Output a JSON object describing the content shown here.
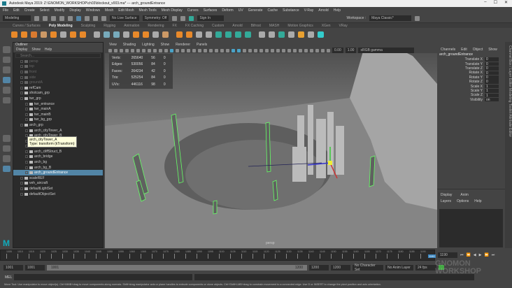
{
  "window": {
    "title": "Autodesk Maya 2019: Z:\\GNOMON_WORKSHOP\\ch03\\blockout_v003.ma*  ---  arch_groundEntrance",
    "minimize": "–",
    "maximize": "☐",
    "close": "✕"
  },
  "menubar": [
    "File",
    "Edit",
    "Create",
    "Select",
    "Modify",
    "Display",
    "Windows",
    "Mesh",
    "Edit Mesh",
    "Mesh Tools",
    "Mesh Display",
    "Curves",
    "Surfaces",
    "Deform",
    "UV",
    "Generate",
    "Cache",
    "Substance",
    "V-Ray",
    "Arnold",
    "Help"
  ],
  "status": {
    "mode": "Modeling",
    "live_surface": "No Live Surface",
    "symmetry": "Symmetry: Off",
    "sign_in": "Sign In",
    "workspace_label": "Workspace :",
    "workspace": "Maya Classic*"
  },
  "shelf_tabs": [
    "Curves / Surfaces",
    "Poly Modeling",
    "Sculpting",
    "Rigging",
    "Animation",
    "Rendering",
    "FX",
    "FX Caching",
    "Custom",
    "Arnold",
    "Bifrost",
    "MASH",
    "Motion Graphics",
    "XGen",
    "VRay"
  ],
  "shelf_active": "Poly Modeling",
  "outliner": {
    "title": "Outliner",
    "menu": [
      "Display",
      "Show",
      "Help"
    ],
    "search_placeholder": "Search...",
    "items": [
      {
        "label": "persp",
        "dim": true,
        "indent": 0
      },
      {
        "label": "top",
        "dim": true,
        "indent": 0
      },
      {
        "label": "front",
        "dim": true,
        "indent": 0
      },
      {
        "label": "side",
        "dim": true,
        "indent": 0
      },
      {
        "label": "groundA",
        "dim": true,
        "indent": 0
      },
      {
        "label": "refCam",
        "indent": 0
      },
      {
        "label": "shotcam_grp",
        "indent": 0
      },
      {
        "label": "twr_grp",
        "indent": 0
      },
      {
        "label": "twr_entrance",
        "indent": 1
      },
      {
        "label": "twr_mainA",
        "indent": 1
      },
      {
        "label": "twr_mainB",
        "indent": 1
      },
      {
        "label": "twr_bg_grp",
        "indent": 1
      },
      {
        "label": "arch_grp",
        "indent": 0
      },
      {
        "label": "arch_cityTower_A",
        "indent": 1
      },
      {
        "label": "arch_cityTower_B",
        "indent": 1
      },
      {
        "label": "arch_cliff",
        "indent": 1
      },
      {
        "label": "arch_cliffStruct_A",
        "indent": 1
      },
      {
        "label": "arch_cliffStruct_B",
        "indent": 1
      },
      {
        "label": "arch_bridge",
        "indent": 1
      },
      {
        "label": "arch_bg",
        "indent": 1
      },
      {
        "label": "arch_bg_B",
        "indent": 1
      },
      {
        "label": "arch_groundEntrance",
        "indent": 1,
        "selected": true
      },
      {
        "label": "scaleREF",
        "indent": 0
      },
      {
        "label": "veh_aircraft",
        "indent": 0
      },
      {
        "label": "defaultLightSet",
        "indent": 0
      },
      {
        "label": "defaultObjectSet",
        "indent": 0
      }
    ],
    "tooltip": {
      "name": "arch_cityTower_A",
      "type": "Type: transform (kTransform)"
    }
  },
  "viewport": {
    "menu": [
      "View",
      "Shading",
      "Lighting",
      "Show",
      "Renderer",
      "Panels"
    ],
    "exposure": "0.00",
    "gamma": "1.00",
    "color_space": "sRGB gamma",
    "camera": "persp",
    "stats": [
      {
        "label": "Verts:",
        "v": "265640",
        "a": "56",
        "b": "0"
      },
      {
        "label": "Edges:",
        "v": "530056",
        "a": "84",
        "b": "0"
      },
      {
        "label": "Faces:",
        "v": "264234",
        "a": "42",
        "b": "0"
      },
      {
        "label": "Tris:",
        "v": "525254",
        "a": "84",
        "b": "0"
      },
      {
        "label": "UVs:",
        "v": "446116",
        "a": "98",
        "b": "0"
      }
    ]
  },
  "channel_box": {
    "menu": [
      "Channels",
      "Edit",
      "Object",
      "Show"
    ],
    "object": "arch_groundEntrance",
    "channels": [
      {
        "l": "Translate X",
        "v": "0"
      },
      {
        "l": "Translate Y",
        "v": "0"
      },
      {
        "l": "Translate Z",
        "v": "0"
      },
      {
        "l": "Rotate X",
        "v": "0"
      },
      {
        "l": "Rotate Y",
        "v": "0"
      },
      {
        "l": "Rotate Z",
        "v": "0"
      },
      {
        "l": "Scale X",
        "v": "1"
      },
      {
        "l": "Scale Y",
        "v": "1"
      },
      {
        "l": "Scale Z",
        "v": "1"
      },
      {
        "l": "Visibility",
        "v": "on"
      }
    ]
  },
  "layer_editor": {
    "tabs": [
      "Display",
      "Anim"
    ],
    "menu": [
      "Layers",
      "Options",
      "Help"
    ]
  },
  "side_tabs": "Channel Box / Layer Editor   Modeling Toolkit   Attribute Editor",
  "timeline": {
    "ticks": [
      "1005",
      "1010",
      "1015",
      "1020",
      "1025",
      "1030",
      "1035",
      "1040",
      "1045",
      "1050",
      "1055",
      "1060",
      "1065",
      "1070",
      "1075",
      "1080",
      "1085",
      "1090",
      "1095",
      "1100",
      "1105",
      "1110",
      "1115",
      "1120",
      "1125",
      "1130",
      "1135",
      "1140",
      "1145",
      "1150",
      "1155",
      "1160",
      "1165",
      "1170",
      "1175",
      "1180",
      "1185",
      "1190"
    ],
    "current": "1190",
    "current_field": "1190"
  },
  "range": {
    "start": "1001",
    "anim_start": "1001",
    "slider_start": "1001",
    "slider_end": "1200",
    "anim_end": "1200",
    "end": "1200",
    "character_set": "No Character Set",
    "anim_layer": "No Anim Layer",
    "fps": "24 fps"
  },
  "mel": {
    "label": "MEL"
  },
  "help_line": "Move Tool: Use manipulator to move object(s). Ctrl+MMB+drag to move components along normals. Shift+drag manipulator axis or plane handles to extrude components or clone objects. Ctrl+Shift+LMB+drag to constrain movement to a connected edge. Use D or INSERT to change the pivot position and axis orientation.",
  "watermark": "GNOMON WORKSHOP"
}
